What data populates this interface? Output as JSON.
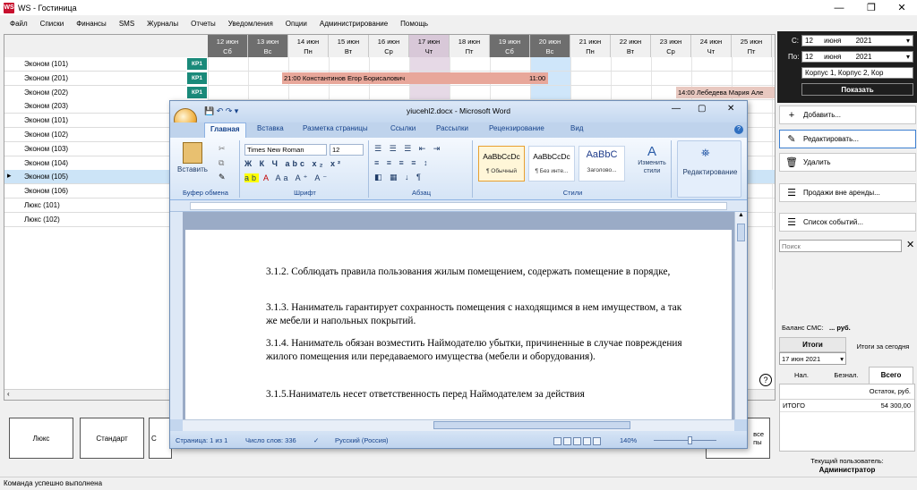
{
  "window": {
    "title": "WS - Гостиница",
    "app_icon": "WS",
    "minimize": "—",
    "maximize": "❐",
    "close": "✕"
  },
  "menu": [
    "Файл",
    "Списки",
    "Финансы",
    "SMS",
    "Журналы",
    "Отчеты",
    "Уведомления",
    "Опции",
    "Администрирование",
    "Помощь"
  ],
  "days": [
    {
      "date": "12 июн",
      "dow": "Сб",
      "weekend": true
    },
    {
      "date": "13 июн",
      "dow": "Вс",
      "weekend": true
    },
    {
      "date": "14 июн",
      "dow": "Пн"
    },
    {
      "date": "15 июн",
      "dow": "Вт"
    },
    {
      "date": "16 июн",
      "dow": "Ср"
    },
    {
      "date": "17 июн",
      "dow": "Чт",
      "today": true
    },
    {
      "date": "18 июн",
      "dow": "Пт"
    },
    {
      "date": "19 июн",
      "dow": "Сб",
      "weekend": true
    },
    {
      "date": "20 июн",
      "dow": "Вс",
      "weekend": true
    },
    {
      "date": "21 июн",
      "dow": "Пн"
    },
    {
      "date": "22 июн",
      "dow": "Вт"
    },
    {
      "date": "23 июн",
      "dow": "Ср"
    },
    {
      "date": "24 июн",
      "dow": "Чт"
    },
    {
      "date": "25 июн",
      "dow": "Пт"
    }
  ],
  "rooms": [
    {
      "name": "Эконом (101)",
      "kp": "КР1"
    },
    {
      "name": "Эконом (201)",
      "kp": "КР1"
    },
    {
      "name": "Эконом (202)",
      "kp": "КР1"
    },
    {
      "name": "Эконом (203)"
    },
    {
      "name": "Эконом (101)"
    },
    {
      "name": "Эконом (102)"
    },
    {
      "name": "Эконом (103)"
    },
    {
      "name": "Эконом (104)"
    },
    {
      "name": "Эконом (105)",
      "selected": true
    },
    {
      "name": "Эконом (106)"
    },
    {
      "name": "Люкс (101)"
    },
    {
      "name": "Люкс (102)"
    }
  ],
  "bookings": {
    "b1": {
      "start": "21:00",
      "guest": "Константинов Егор Борисалович",
      "end": "11:00",
      "color": "#e8a79a"
    },
    "b2": {
      "start": "14:00",
      "guest": "Лебедева Мария Але",
      "color": "#e8c8c0"
    }
  },
  "bottom_buttons": [
    "Люкс",
    "Стандарт",
    "С",
    "все\nпы"
  ],
  "right_panel": {
    "from_label": "С:",
    "from_day": "12",
    "from_month": "июня",
    "from_year": "2021",
    "to_label": "По:",
    "to_day": "12",
    "to_month": "июня",
    "to_year": "2021",
    "buildings": "Корпус 1, Корпус 2, Кор",
    "show_button": "Показать",
    "add": "Добавить...",
    "edit": "Редактировать...",
    "delete": "Удалить",
    "sales": "Продажи вне аренды...",
    "events": "Список событий...",
    "search_placeholder": "Поиск",
    "sms_balance": "Баланс СМС:",
    "sms_value": "... руб.",
    "totals_btn": "Итоги",
    "totals_today": "Итоги за сегодня",
    "date": "17 июн 2021",
    "tabs": [
      "Нал.",
      "Безнал.",
      "Всего"
    ],
    "col_header": "Остаток, руб.",
    "total_label": "ИТОГО",
    "total_value": "54 300,00",
    "user_label": "Текущий пользователь:",
    "user_name": "Администратор",
    "help": "?"
  },
  "status": "Команда успешно выполнена",
  "word": {
    "title": "yiucehl2.docx - Microsoft Word",
    "tabs": [
      "Главная",
      "Вставка",
      "Разметка страницы",
      "Ссылки",
      "Рассылки",
      "Рецензирование",
      "Вид"
    ],
    "paste": "Вставить",
    "clipboard": "Буфер обмена",
    "font_group": "Шрифт",
    "para_group": "Абзац",
    "styles_group": "Стили",
    "edit_group": "Редактирование",
    "font": "Times New Roman",
    "size": "12",
    "style1": "AaBbCcDc",
    "style1_name": "¶ Обычный",
    "style2": "AaBbCcDc",
    "style2_name": "¶ Без инте...",
    "style3": "AaBbC",
    "style3_name": "Заголово...",
    "change_styles": "Изменить стили",
    "paragraphs": [
      "3.1.2. Соблюдать правила пользования жилым помещением, содержать помещение в порядке,",
      "3.1.3. Наниматель гарантирует сохранность помещения с находящимся в нем имуществом, а так же мебели и напольных покрытий.",
      "3.1.4. Наниматель обязан возместить Наймодателю убытки, причиненные в случае повреждения жилого помещения или передаваемого имущества (мебели и оборудования).",
      "3.1.5.Наниматель несет ответственность перед Наймодателем за действия"
    ],
    "status_page": "Страница: 1 из 1",
    "status_words": "Число слов: 336",
    "status_lang": "Русский (Россия)",
    "zoom": "140%"
  }
}
